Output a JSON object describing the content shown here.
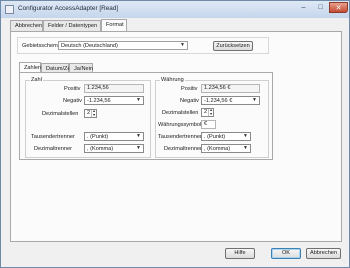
{
  "window": {
    "title": "Configurator AccessAdapter [Read]",
    "min_glyph": "–",
    "max_glyph": "□",
    "close_glyph": "✕"
  },
  "outer_tabs": [
    {
      "label": "Abbrechen"
    },
    {
      "label": "Felder / Datentypen"
    },
    {
      "label": "Format"
    }
  ],
  "format": {
    "locale_label": "Gebietsschema",
    "locale_value": "Deutsch (Deutschland)",
    "reset_button": "Zurücksetzen",
    "inner_tabs": [
      {
        "label": "Zahlen"
      },
      {
        "label": "Datum/Zeit"
      },
      {
        "label": "Ja/Nein"
      }
    ],
    "zahl": {
      "title": "Zahl",
      "positiv_label": "Positiv",
      "positiv_value": "1.234,56",
      "negativ_label": "Negativ",
      "negativ_value": "-1.234,56",
      "dezimalstellen_label": "Dezimalstellen",
      "dezimalstellen_value": "2",
      "tausender_label": "Tausendertrenner",
      "tausender_value": ". (Punkt)",
      "dezimal_label": "Dezimaltrenner",
      "dezimal_value": ", (Komma)"
    },
    "waehrung": {
      "title": "Währung",
      "positiv_label": "Positiv",
      "positiv_value": "1.234,56 €",
      "negativ_label": "Negativ",
      "negativ_value": "-1.234,56 €",
      "dezimalstellen_label": "Dezimalstellen",
      "dezimalstellen_value": "2",
      "symbol_label": "Währungssymbol",
      "symbol_value": "€",
      "tausender_label": "Tausendertrenner",
      "tausender_value": ". (Punkt)",
      "dezimal_label": "Dezimaltrenner",
      "dezimal_value": ", (Komma)"
    }
  },
  "footer": {
    "help": "Hilfe",
    "ok": "OK",
    "cancel": "Abbrechen"
  }
}
